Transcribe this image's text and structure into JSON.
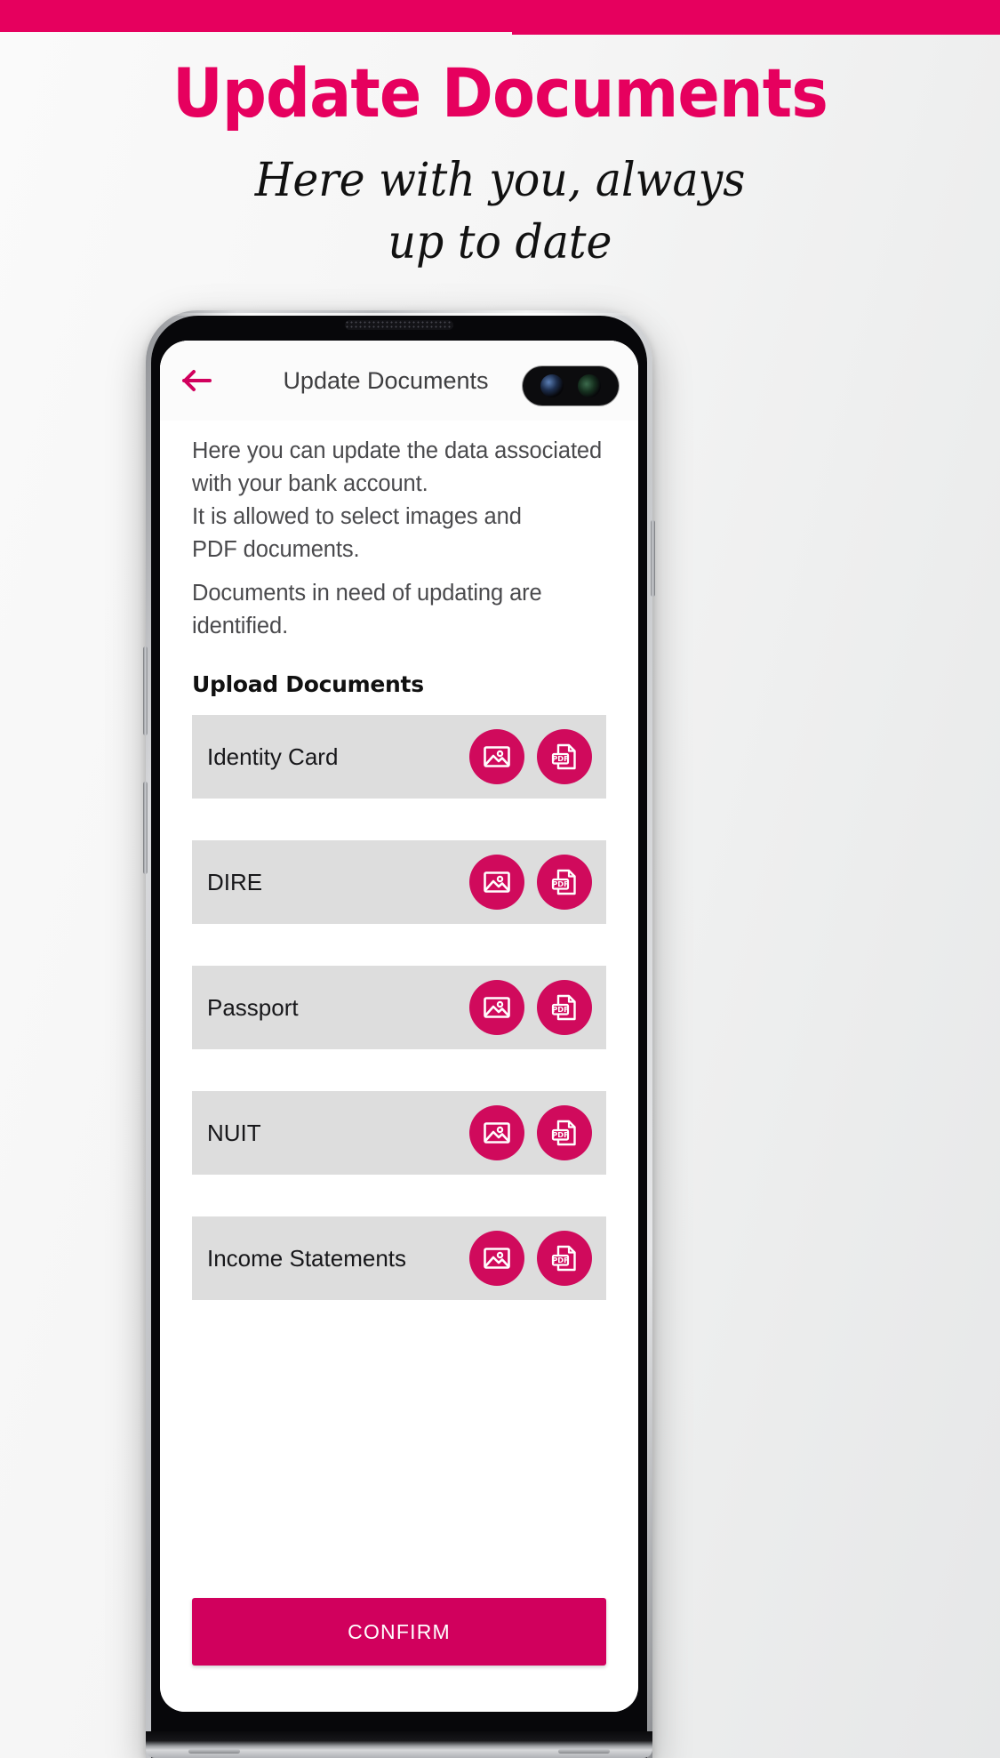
{
  "promo": {
    "title": "Update Documents",
    "subtitle_line1": "Here with you, always",
    "subtitle_line2": "up to date",
    "banner_color": "#e6005e",
    "title_color": "#e6005e"
  },
  "phone": {
    "earpiece_icon": "earpiece-speaker-icon",
    "camera_icon": "front-camera-icon"
  },
  "app": {
    "header": {
      "back_icon": "back-arrow-icon",
      "title": "Update Documents"
    },
    "intro": {
      "line1": "Here you can update the data associated",
      "line2": "with your bank account.",
      "line3": "It is allowed to select images and",
      "line4": "PDF documents.",
      "line5": "Documents in need of updating are identified."
    },
    "section_title": "Upload Documents",
    "documents": [
      {
        "label": "Identity Card",
        "image_icon": "image-upload-icon",
        "pdf_icon": "pdf-upload-icon"
      },
      {
        "label": "DIRE",
        "image_icon": "image-upload-icon",
        "pdf_icon": "pdf-upload-icon"
      },
      {
        "label": "Passport",
        "image_icon": "image-upload-icon",
        "pdf_icon": "pdf-upload-icon"
      },
      {
        "label": "NUIT",
        "image_icon": "image-upload-icon",
        "pdf_icon": "pdf-upload-icon"
      },
      {
        "label": "Income Statements",
        "image_icon": "image-upload-icon",
        "pdf_icon": "pdf-upload-icon"
      }
    ],
    "confirm_label": "CONFIRM",
    "accent_color": "#d1005d",
    "row_background": "#dddddd"
  }
}
